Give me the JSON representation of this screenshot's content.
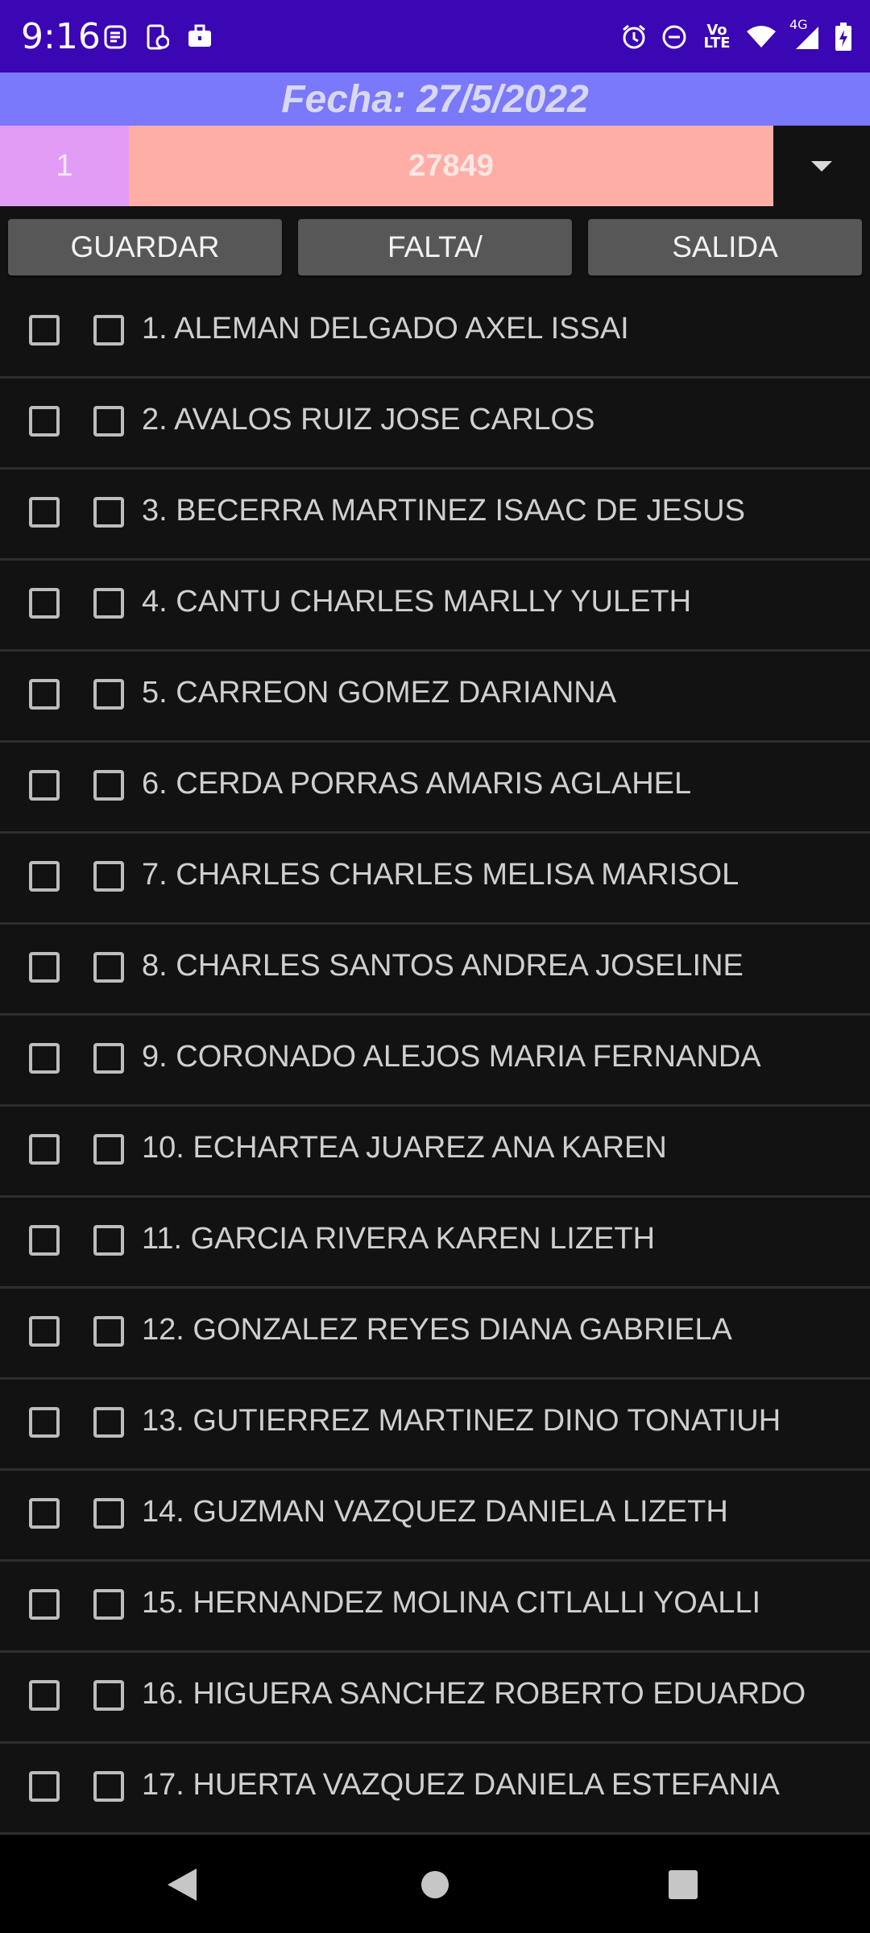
{
  "status_bar": {
    "time": "9:16",
    "left_icons": [
      "nfc-icon",
      "phone-sync-icon",
      "work-bag-icon"
    ],
    "right_icons": [
      "alarm-icon",
      "do-not-disturb-icon",
      "volte-icon",
      "wifi-icon",
      "4g-signal-icon",
      "battery-icon"
    ],
    "volte_text": "Vo LTE",
    "network_text": "4G",
    "background_color": "#3b06b3"
  },
  "header": {
    "title": "Fecha: 27/5/2022",
    "background_color": "#7a78fb"
  },
  "selector": {
    "group_value": "1",
    "code_value": "27849",
    "group_color": "#e39cf6",
    "code_color": "#ffaea6"
  },
  "toolbar": {
    "save_label": "GUARDAR",
    "absence_label": "FALTA/",
    "exit_label": "SALIDA"
  },
  "students": [
    {
      "label": "1. ALEMAN DELGADO AXEL ISSAI",
      "check_a": false,
      "check_b": false
    },
    {
      "label": "2. AVALOS RUIZ JOSE CARLOS",
      "check_a": false,
      "check_b": false
    },
    {
      "label": "3. BECERRA MARTINEZ ISAAC DE JESUS",
      "check_a": false,
      "check_b": false
    },
    {
      "label": "4. CANTU CHARLES MARLLY YULETH",
      "check_a": false,
      "check_b": false
    },
    {
      "label": "5. CARREON GOMEZ DARIANNA",
      "check_a": false,
      "check_b": false
    },
    {
      "label": "6. CERDA PORRAS AMARIS AGLAHEL",
      "check_a": false,
      "check_b": false
    },
    {
      "label": "7. CHARLES CHARLES MELISA MARISOL",
      "check_a": false,
      "check_b": false
    },
    {
      "label": "8. CHARLES SANTOS ANDREA JOSELINE",
      "check_a": false,
      "check_b": false
    },
    {
      "label": "9. CORONADO ALEJOS MARIA FERNANDA",
      "check_a": false,
      "check_b": false
    },
    {
      "label": "10. ECHARTEA JUAREZ ANA KAREN",
      "check_a": false,
      "check_b": false
    },
    {
      "label": "11. GARCIA RIVERA KAREN LIZETH",
      "check_a": false,
      "check_b": false
    },
    {
      "label": "12. GONZALEZ REYES DIANA GABRIELA",
      "check_a": false,
      "check_b": false
    },
    {
      "label": "13. GUTIERREZ MARTINEZ DINO TONATIUH",
      "check_a": false,
      "check_b": false
    },
    {
      "label": "14. GUZMAN VAZQUEZ DANIELA LIZETH",
      "check_a": false,
      "check_b": false
    },
    {
      "label": "15. HERNANDEZ MOLINA CITLALLI YOALLI",
      "check_a": false,
      "check_b": false
    },
    {
      "label": "16. HIGUERA SANCHEZ ROBERTO EDUARDO",
      "check_a": false,
      "check_b": false
    },
    {
      "label": "17. HUERTA VAZQUEZ DANIELA ESTEFANIA",
      "check_a": false,
      "check_b": false
    }
  ],
  "nav_bar": {
    "icons": [
      "back-icon",
      "home-icon",
      "recents-icon"
    ]
  }
}
